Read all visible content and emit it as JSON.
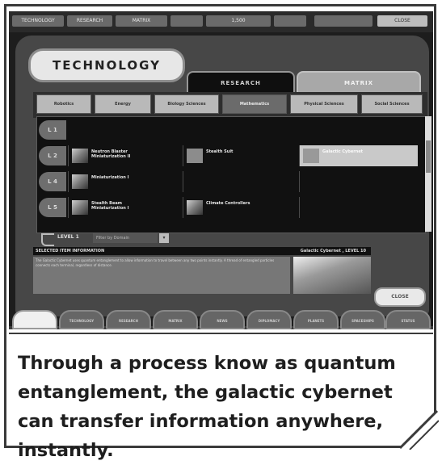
{
  "top_bar": {
    "items": [
      "TECHNOLOGY",
      "RESEARCH",
      "MATRIX",
      "",
      "1,500",
      "",
      "",
      "CLOSE"
    ]
  },
  "main_tabs": {
    "technology": "TECHNOLOGY",
    "research": "RESEARCH",
    "matrix": "MATRIX"
  },
  "sub_tabs": [
    {
      "label": "Robotics"
    },
    {
      "label": "Energy"
    },
    {
      "label": "Biology Sciences"
    },
    {
      "label": "Mathematics",
      "active": true
    },
    {
      "label": "Physical Sciences"
    },
    {
      "label": "Social Sciences"
    }
  ],
  "grid": {
    "rows": [
      {
        "level": "L 1",
        "cells": [
          "",
          "",
          ""
        ]
      },
      {
        "level": "L 2",
        "cells": [
          "Neutron Blaster\nMiniaturization II",
          "Stealth Suit",
          "Galactic Cybernet"
        ]
      },
      {
        "level": "L 4",
        "cells": [
          "Miniaturization I",
          "",
          ""
        ]
      },
      {
        "level": "L 5",
        "cells": [
          "Stealth Beam\nMiniaturization I",
          "Climate Controllers",
          ""
        ]
      }
    ]
  },
  "level_select": {
    "label": "LEVEL 1",
    "value": "Filter by Domain"
  },
  "info": {
    "header_left": "SELECTED ITEM INFORMATION",
    "header_right": "Galactic Cybernet , LEVEL 10",
    "body": "The Galactic Cybernet uses quantum entanglement to allow information to travel between any two points instantly. A thread of entangled particles connects each terminal, regardless of distance."
  },
  "close_button": "CLOSE",
  "bottom_tabs": [
    "",
    "TECHNOLOGY",
    "RESEARCH",
    "MATRIX",
    "NEWS",
    "DIPLOMACY",
    "PLANETS",
    "SPACESHIPS",
    "STATUS"
  ],
  "caption": "Through a process know as quantum entanglement, the galactic cybernet can transfer information anywhere, instantly."
}
